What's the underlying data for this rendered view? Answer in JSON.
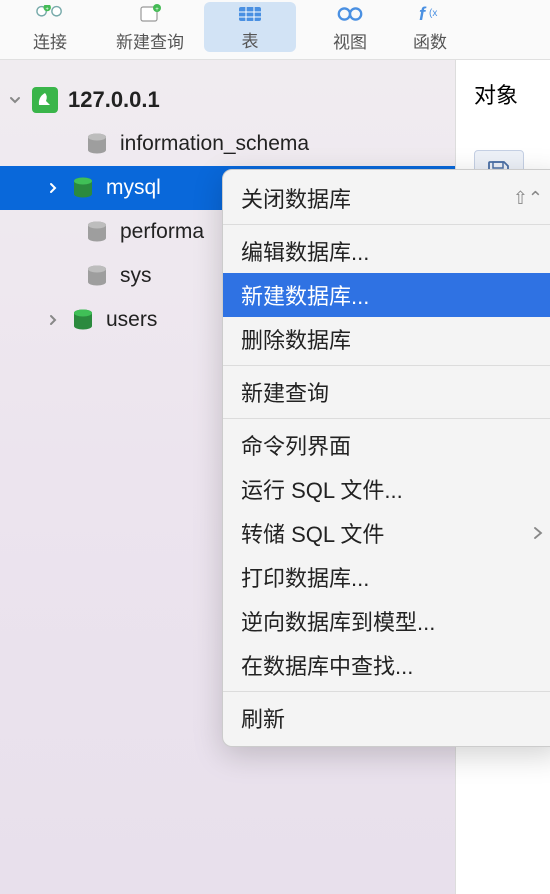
{
  "toolbar": {
    "connect": "连接",
    "new_query": "新建查询",
    "table": "表",
    "view": "视图",
    "func": "函数"
  },
  "right": {
    "title": "对象"
  },
  "server": {
    "name": "127.0.0.1",
    "dbs": [
      {
        "name": "information_schema",
        "open": false,
        "expanded": false
      },
      {
        "name": "mysql",
        "open": true,
        "expanded": false
      },
      {
        "name": "performa",
        "open": false,
        "expanded": false
      },
      {
        "name": "sys",
        "open": false,
        "expanded": false
      },
      {
        "name": "users",
        "open": true,
        "expanded": false
      }
    ]
  },
  "menu": {
    "close_db": "关闭数据库",
    "edit_db": "编辑数据库...",
    "new_db": "新建数据库...",
    "delete_db": "删除数据库",
    "new_query": "新建查询",
    "cli": "命令列界面",
    "run_sql": "运行 SQL 文件...",
    "dump_sql": "转储 SQL 文件",
    "print_db": "打印数据库...",
    "reverse_model": "逆向数据库到模型...",
    "find_in_db": "在数据库中查找...",
    "refresh": "刷新",
    "shortcut_close": "⇧⌃"
  }
}
